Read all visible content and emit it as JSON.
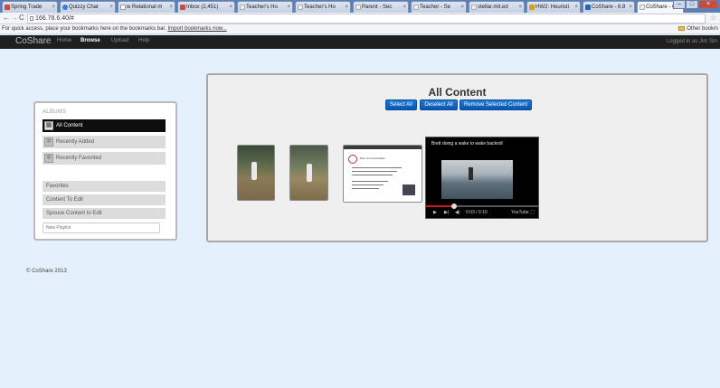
{
  "browser": {
    "tabs": [
      {
        "label": "Spring Trade",
        "color": "#d34a3a",
        "active": false
      },
      {
        "label": "Quizzy Chat",
        "color": "#3b7bd6",
        "active": false
      },
      {
        "label": "w Relational m",
        "color": "#ffffff",
        "active": false
      },
      {
        "label": "Inbox (2,451)",
        "color": "#d34a3a",
        "active": false
      },
      {
        "label": "Teacher's Ho",
        "color": "#e9e9e9",
        "active": false
      },
      {
        "label": "Teacher's Ho",
        "color": "#e9e9e9",
        "active": false
      },
      {
        "label": "Parent - Sec",
        "color": "#e9e9e9",
        "active": false
      },
      {
        "label": "Teacher - Se",
        "color": "#e9e9e9",
        "active": false
      },
      {
        "label": "stellar.mit.ed",
        "color": "#e9e9e9",
        "active": false
      },
      {
        "label": "HW2: Heuristi",
        "color": "#d8a01e",
        "active": false
      },
      {
        "label": "CoShare - 6.8",
        "color": "#2d64b8",
        "active": false
      },
      {
        "label": "CoShare - Co",
        "color": "#e9e9e9",
        "active": true
      }
    ],
    "url": "166.78.6.40/#",
    "bookmarks_prompt": "For quick access, place your bookmarks here on the bookmarks bar.",
    "import_link": "Import bookmarks now...",
    "other_bookmarks": "Other bookm"
  },
  "navbar": {
    "brand": "CoShare",
    "links": [
      "Home",
      "Browse",
      "Upload",
      "Help"
    ],
    "logged_in": "Logged in as Jim Sm"
  },
  "albums": {
    "heading": "ALBUMS",
    "items": [
      "All Content",
      "Recently Added",
      "Recently Favorited"
    ],
    "lists": [
      "Favorites",
      "Content To Edit",
      "Spouse Content to Edit"
    ],
    "playlist_placeholder": "New Playlist"
  },
  "content": {
    "title": "All Content",
    "buttons": [
      "Select All",
      "Deselect All",
      "Remove Selected Content"
    ],
    "slide_title": "Peer Communication",
    "video": {
      "title": "Brett doing a wake to wake backroll",
      "time": "0:03 / 0:10",
      "played_fraction": 0.25,
      "logo": "YouTube"
    }
  },
  "footer": "© CoShare 2013"
}
